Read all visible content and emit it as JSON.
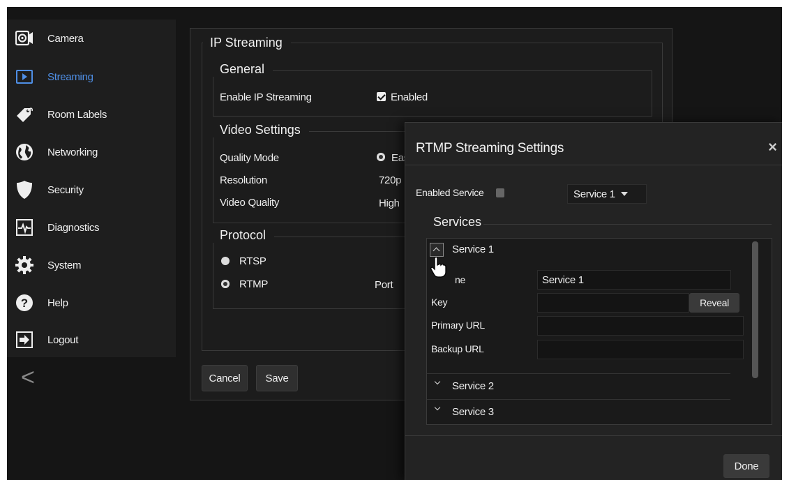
{
  "sidebar": {
    "items": [
      {
        "label": "Camera",
        "icon": "camera-icon"
      },
      {
        "label": "Streaming",
        "icon": "play-icon",
        "active": true
      },
      {
        "label": "Room Labels",
        "icon": "tag-icon"
      },
      {
        "label": "Networking",
        "icon": "globe-icon"
      },
      {
        "label": "Security",
        "icon": "shield-icon"
      },
      {
        "label": "Diagnostics",
        "icon": "pulse-icon"
      },
      {
        "label": "System",
        "icon": "gear-icon"
      },
      {
        "label": "Help",
        "icon": "help-icon"
      },
      {
        "label": "Logout",
        "icon": "logout-icon"
      }
    ],
    "collapse_symbol": "<"
  },
  "main": {
    "title": "IP Streaming",
    "general": {
      "legend": "General",
      "enable_label": "Enable IP Streaming",
      "enable_value": "Enabled"
    },
    "video": {
      "legend": "Video Settings",
      "quality_mode_label": "Quality Mode",
      "quality_mode_value": "Eas",
      "resolution_label": "Resolution",
      "resolution_value": "720p",
      "video_quality_label": "Video Quality",
      "video_quality_value": "High"
    },
    "protocol": {
      "legend": "Protocol",
      "rtsp_label": "RTSP",
      "rtmp_label": "RTMP",
      "port_label": "Port",
      "selected": "RTMP"
    },
    "cancel_label": "Cancel",
    "save_label": "Save"
  },
  "modal": {
    "title": "RTMP Streaming Settings",
    "close_symbol": "×",
    "enabled_service_label": "Enabled Service",
    "enabled_service_value": "Service 1",
    "services_legend": "Services",
    "service1": {
      "header": "Service 1",
      "name_label": "ne",
      "name_value": "Service 1",
      "key_label": "Key",
      "reveal_label": "Reveal",
      "primary_url_label": "Primary URL",
      "backup_url_label": "Backup URL"
    },
    "service2_header": "Service 2",
    "service3_header": "Service 3",
    "done_label": "Done"
  },
  "colors": {
    "background": "#151515",
    "panel": "#1c1c1c",
    "accent_active": "#4f8fe6"
  }
}
